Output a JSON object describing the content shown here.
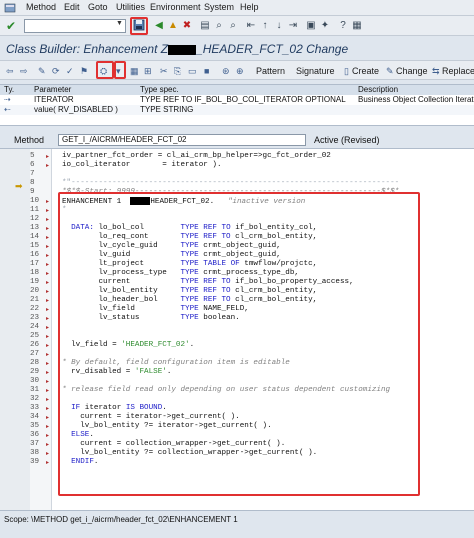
{
  "menu": {
    "items": [
      "Method",
      "Edit",
      "Goto",
      "Utilities",
      "Environment",
      "System",
      "Help"
    ]
  },
  "std_toolbar": {
    "command_placeholder": "",
    "icons": [
      "save-icon",
      "back-icon",
      "exit-icon",
      "cancel-icon",
      "print-icon",
      "find-icon",
      "find-next-icon",
      "first-page-icon",
      "previous-page-icon",
      "next-page-icon",
      "last-page-icon",
      "new-session-icon",
      "shortcut-icon",
      "help-icon",
      "layout-icon"
    ]
  },
  "title": {
    "prefix": "Class Builder: Enhancement Z",
    "suffix": "_HEADER_FCT_02 Change"
  },
  "app_toolbar": {
    "pattern": "Pattern",
    "signature": "Signature",
    "create": "Create",
    "change": "Change",
    "replace": "Replace"
  },
  "params": {
    "headers": [
      "Ty.",
      "Parameter",
      "Type spec.",
      "Description"
    ],
    "rows": [
      [
        "",
        "ITERATOR",
        "TYPE REF TO IF_BOL_BO_COL_ITERATOR OPTIONAL",
        "Business Object Collection Iterator I"
      ],
      [
        "",
        "value( RV_DISABLED )",
        "TYPE STRING",
        ""
      ]
    ]
  },
  "method": {
    "label": "Method",
    "name": "GET_I_/AICRM/HEADER_FCT_02",
    "status": "Active (Revised)"
  },
  "code": [
    {
      "n": "5",
      "segs": [
        [
          "",
          "iv_partner_fct_order = cl_ai_crm_bp_helper=>gc_fct_order_02"
        ]
      ]
    },
    {
      "n": "6",
      "segs": [
        [
          "",
          "io_col_iterator       = iterator )."
        ]
      ]
    },
    {
      "n": "7",
      "segs": [
        [
          "",
          ""
        ]
      ]
    },
    {
      "n": "8",
      "segs": [
        [
          "dash",
          "*\"------------------------------------------------------------------------"
        ]
      ]
    },
    {
      "n": "9",
      "segs": [
        [
          "cm",
          "*$*$-Start: 9999------------------------------------------------------$*$*"
        ]
      ]
    },
    {
      "n": "10",
      "segs": [
        [
          "",
          "ENHANCEMENT 1  "
        ],
        [
          "black",
          ""
        ],
        [
          "",
          "HEADER_FCT_02.   "
        ],
        [
          "cm",
          "\"inactive version"
        ]
      ]
    },
    {
      "n": "11",
      "segs": [
        [
          "dash",
          "*"
        ]
      ]
    },
    {
      "n": "12",
      "segs": [
        [
          "",
          ""
        ]
      ]
    },
    {
      "n": "13",
      "segs": [
        [
          "kw",
          "  DATA: "
        ],
        [
          "",
          "lo_bol_col        "
        ],
        [
          "kw",
          "TYPE REF TO "
        ],
        [
          "",
          "if_bol_entity_col,"
        ]
      ]
    },
    {
      "n": "14",
      "segs": [
        [
          "",
          "        lo_req_cont       "
        ],
        [
          "kw",
          "TYPE REF TO "
        ],
        [
          "",
          "cl_crm_bol_entity,"
        ]
      ]
    },
    {
      "n": "15",
      "segs": [
        [
          "",
          "        lv_cycle_guid     "
        ],
        [
          "kw",
          "TYPE "
        ],
        [
          "",
          "crmt_object_guid,"
        ]
      ]
    },
    {
      "n": "16",
      "segs": [
        [
          "",
          "        lv_guid           "
        ],
        [
          "kw",
          "TYPE "
        ],
        [
          "",
          "crmt_object_guid,"
        ]
      ]
    },
    {
      "n": "17",
      "segs": [
        [
          "",
          "        lt_project        "
        ],
        [
          "kw",
          "TYPE TABLE OF "
        ],
        [
          "",
          "tmwflow/projctc,"
        ]
      ]
    },
    {
      "n": "18",
      "segs": [
        [
          "",
          "        lv_process_type   "
        ],
        [
          "kw",
          "TYPE "
        ],
        [
          "",
          "crmt_process_type_db,"
        ]
      ]
    },
    {
      "n": "19",
      "segs": [
        [
          "",
          "        current           "
        ],
        [
          "kw",
          "TYPE REF TO "
        ],
        [
          "",
          "if_bol_bo_property_access,"
        ]
      ]
    },
    {
      "n": "20",
      "segs": [
        [
          "",
          "        lv_bol_entity     "
        ],
        [
          "kw",
          "TYPE REF TO "
        ],
        [
          "",
          "cl_crm_bol_entity,"
        ]
      ]
    },
    {
      "n": "21",
      "segs": [
        [
          "",
          "        lo_header_bol     "
        ],
        [
          "kw",
          "TYPE REF TO "
        ],
        [
          "",
          "cl_crm_bol_entity,"
        ]
      ]
    },
    {
      "n": "22",
      "segs": [
        [
          "",
          "        lv_field          "
        ],
        [
          "kw",
          "TYPE "
        ],
        [
          "",
          "NAME_FELD,"
        ]
      ]
    },
    {
      "n": "23",
      "segs": [
        [
          "",
          "        lv_status         "
        ],
        [
          "kw",
          "TYPE "
        ],
        [
          "",
          "boolean."
        ]
      ]
    },
    {
      "n": "24",
      "segs": [
        [
          "",
          ""
        ]
      ]
    },
    {
      "n": "25",
      "segs": [
        [
          "",
          ""
        ]
      ]
    },
    {
      "n": "26",
      "segs": [
        [
          "",
          "  lv_field = "
        ],
        [
          "str",
          "'HEADER_FCT_02'"
        ],
        [
          "",
          "."
        ]
      ]
    },
    {
      "n": "27",
      "segs": [
        [
          "",
          ""
        ]
      ]
    },
    {
      "n": "28",
      "segs": [
        [
          "cm",
          "* By default, field configuration item is editable"
        ]
      ]
    },
    {
      "n": "29",
      "segs": [
        [
          "",
          "  rv_disabled = "
        ],
        [
          "str",
          "'FALSE'"
        ],
        [
          "",
          "."
        ]
      ]
    },
    {
      "n": "30",
      "segs": [
        [
          "",
          ""
        ]
      ]
    },
    {
      "n": "31",
      "segs": [
        [
          "cm",
          "* release field read only depending on user status dependent customizing"
        ]
      ]
    },
    {
      "n": "32",
      "segs": [
        [
          "",
          ""
        ]
      ]
    },
    {
      "n": "33",
      "segs": [
        [
          "kw",
          "  IF "
        ],
        [
          "",
          "iterator "
        ],
        [
          "kw",
          "IS BOUND"
        ],
        [
          "",
          "."
        ]
      ]
    },
    {
      "n": "34",
      "segs": [
        [
          "",
          "    current = iterator->get_current( )."
        ]
      ]
    },
    {
      "n": "35",
      "segs": [
        [
          "",
          "    lv_bol_entity ?= iterator->get_current( )."
        ]
      ]
    },
    {
      "n": "36",
      "segs": [
        [
          "kw",
          "  ELSE"
        ],
        [
          "",
          "."
        ]
      ]
    },
    {
      "n": "37",
      "segs": [
        [
          "",
          "    current = collection_wrapper->get_current( )."
        ]
      ]
    },
    {
      "n": "38",
      "segs": [
        [
          "",
          "    lv_bol_entity ?= collection_wrapper->get_current( )."
        ]
      ]
    },
    {
      "n": "39",
      "segs": [
        [
          "kw",
          "  ENDIF"
        ],
        [
          "",
          "."
        ]
      ]
    }
  ],
  "status": {
    "scope": "Scope: \\METHOD get_i_/aicrm/header_fct_02\\ENHANCEMENT 1"
  },
  "colors": {
    "highlight_red": "#e03030",
    "keyword_blue": "#1e1ec8",
    "string_green": "#2e8b2e",
    "title_blue": "#1f3a5f"
  }
}
